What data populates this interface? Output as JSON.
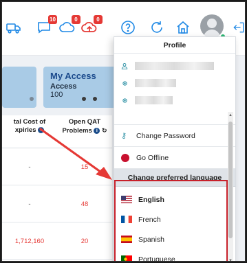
{
  "nav": {
    "badges": {
      "chat": "10",
      "sync": "0",
      "upload": "0"
    }
  },
  "cards": {
    "access": {
      "title": "My Access",
      "subtitle": "Access",
      "value": "100"
    }
  },
  "table": {
    "headers": {
      "total_cost": "tal Cost of",
      "total_cost_line2": "xpiries",
      "open_qat": "Open QAT",
      "open_qat_line2": "Problems"
    },
    "rows": [
      {
        "total_cost": "-",
        "open_qat": "15"
      },
      {
        "total_cost": "-",
        "open_qat": "48"
      },
      {
        "total_cost": "1,712,160",
        "open_qat": "20"
      }
    ]
  },
  "dropdown": {
    "header": "Profile",
    "items": {
      "change_password": "Change Password",
      "go_offline": "Go Offline"
    },
    "section": "Change preferred language",
    "languages": [
      {
        "label": "English"
      },
      {
        "label": "French"
      },
      {
        "label": "Spanish"
      },
      {
        "label": "Portuguese"
      }
    ]
  },
  "colors": {
    "highlight": "#c8202a",
    "card": "#a9cbe6",
    "online": "#2bb673"
  }
}
